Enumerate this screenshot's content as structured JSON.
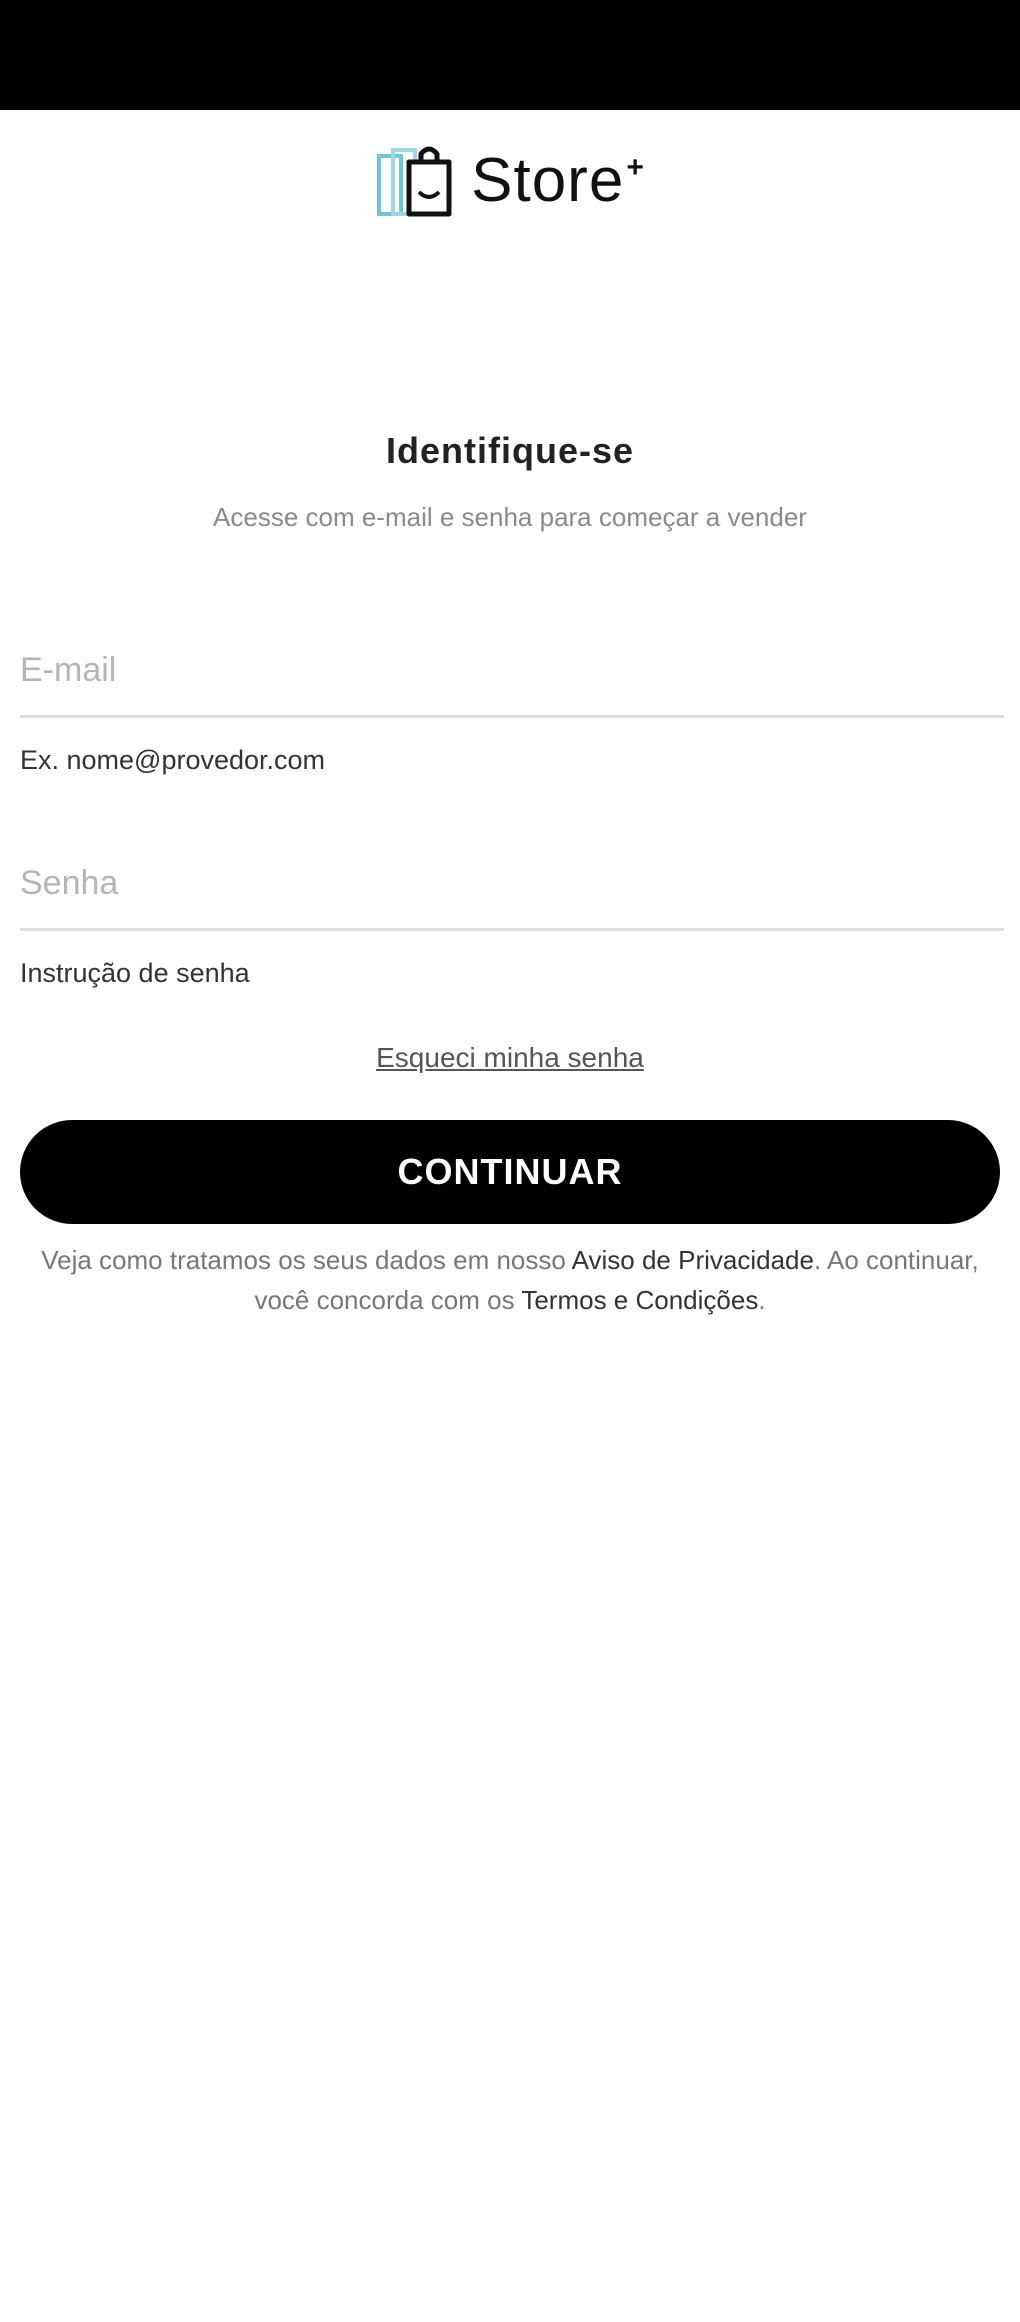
{
  "logo": {
    "icon": "shopping-bag-icon",
    "text": "Store",
    "superscript": "+"
  },
  "heading": "Identifique-se",
  "subheading": "Acesse com e-mail e senha para começar a vender",
  "email": {
    "placeholder": "E-mail",
    "value": "",
    "helper": "Ex. nome@provedor.com"
  },
  "password": {
    "placeholder": "Senha",
    "value": "",
    "helper": "Instrução de senha"
  },
  "forgot_link": "Esqueci minha senha",
  "continue_button": "CONTINUAR",
  "legal": {
    "part1": "Veja como tratamos os seus dados em nosso ",
    "privacy_link": "Aviso de Privacidade",
    "part2": ". Ao continuar, você concorda com os ",
    "terms_link": "Termos e Condições",
    "part3": "."
  },
  "colors": {
    "status_bar": "#000000",
    "button_bg": "#000000",
    "button_text": "#ffffff",
    "logo_accent": "#6ec6d8"
  }
}
